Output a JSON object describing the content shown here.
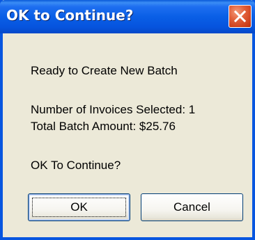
{
  "dialog": {
    "title": "OK to Continue?",
    "close_icon": "close-x-icon",
    "colors": {
      "titlebar": "#0a5fe6",
      "close_button": "#e2603a",
      "body": "#ece9d8"
    }
  },
  "message": {
    "heading": "Ready to Create New Batch",
    "invoices_line": "Number of Invoices Selected: 1",
    "amount_line": "Total Batch Amount: $25.76",
    "prompt": "OK To Continue?"
  },
  "buttons": {
    "ok_label": "OK",
    "cancel_label": "Cancel"
  }
}
